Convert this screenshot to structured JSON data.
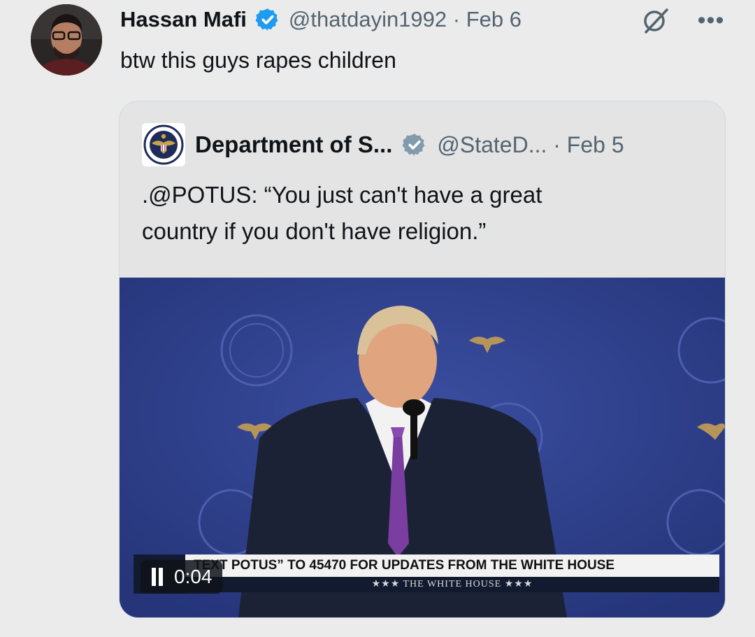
{
  "tweet": {
    "author_name": "Hassan Mafi",
    "handle": "@thatdayin1992",
    "separator": "·",
    "date": "Feb 6",
    "text": "btw this guys rapes children",
    "icons": [
      "verified-badge-icon",
      "grok-icon",
      "more-icon"
    ],
    "more_glyph": "•••"
  },
  "quote": {
    "author_name": "Department of S...",
    "handle": "@StateD...",
    "separator": "·",
    "date": "Feb 5",
    "text_line1": ".@POTUS: “You just can't have a great",
    "text_line2": "country if you don't have religion.”",
    "media": {
      "ticker_text": "POTUS” TO 45470 FOR UPDATES FROM THE WHITE HOUSE",
      "ticker_text_prefix": "TEXT",
      "ticker_sub": "★★★  THE WHITE HOUSE  ★★★",
      "time": "0:04",
      "state": "playing"
    }
  },
  "colors": {
    "background": "#ebebeb",
    "verified_blue": "#1d9bf0",
    "verified_gray": "#829aab",
    "muted_text": "#536471",
    "stage_blue": "#2e3f8c"
  }
}
